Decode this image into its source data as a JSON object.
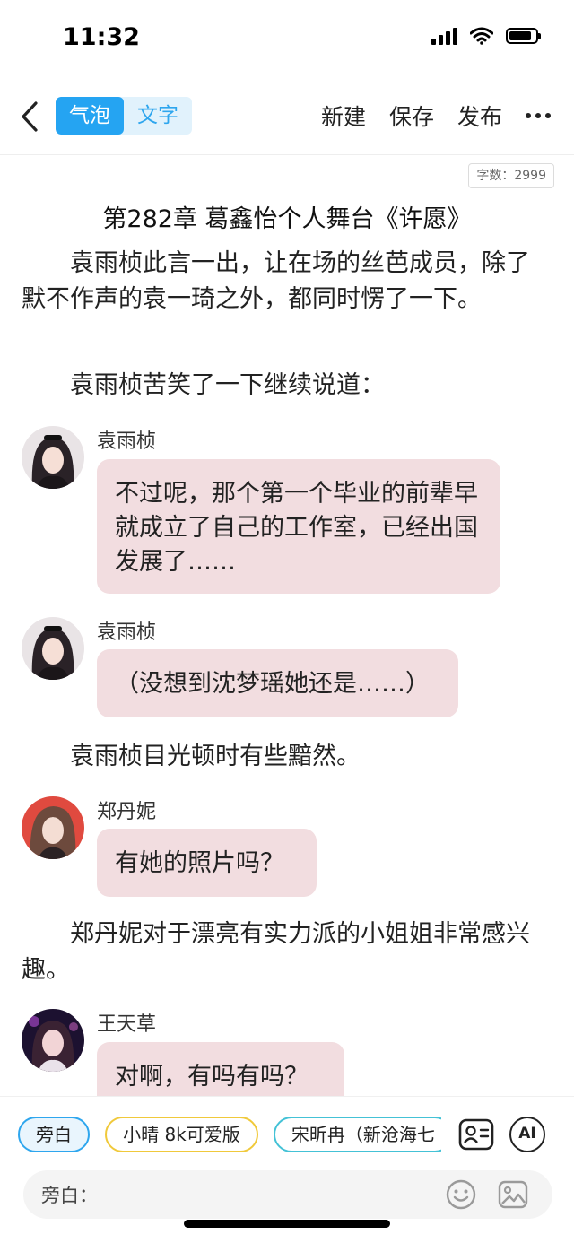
{
  "status_bar": {
    "time": "11:32",
    "battery_level": 0.85
  },
  "nav": {
    "modes": [
      "气泡",
      "文字"
    ],
    "active_mode": "气泡",
    "actions": {
      "new": "新建",
      "save": "保存",
      "publish": "发布"
    }
  },
  "document": {
    "word_count": "字数：2999",
    "title": "第282章 葛鑫怡个人舞台《许愿》",
    "blocks": {
      "p1": "　　袁雨桢此言一出，让在场的丝芭成员，除了默不作声的袁一琦之外，都同时愣了一下。",
      "p2": "　　袁雨桢苦笑了一下继续说道：",
      "msg1": {
        "speaker": "袁雨桢",
        "text": "不过呢，那个第一个毕业的前辈早就成立了自己的工作室，已经出国发展了……"
      },
      "msg2": {
        "speaker": "袁雨桢",
        "text": "（没想到沈梦瑶她还是……）"
      },
      "p3": "　　袁雨桢目光顿时有些黯然。",
      "msg3": {
        "speaker": "郑丹妮",
        "text": "有她的照片吗？"
      },
      "p4": "　　郑丹妮对于漂亮有实力派的小姐姐非常感兴趣。",
      "msg4": {
        "speaker": "王天草",
        "text": "对啊，有吗有吗？"
      }
    }
  },
  "bottom": {
    "roles": [
      "旁白",
      "小晴 8k可爱版",
      "宋昕冉（新沧海七"
    ],
    "ai_label": "AI",
    "input_label": "旁白："
  },
  "colors": {
    "accent": "#25a4f2",
    "bubble": "#f2dde0"
  }
}
